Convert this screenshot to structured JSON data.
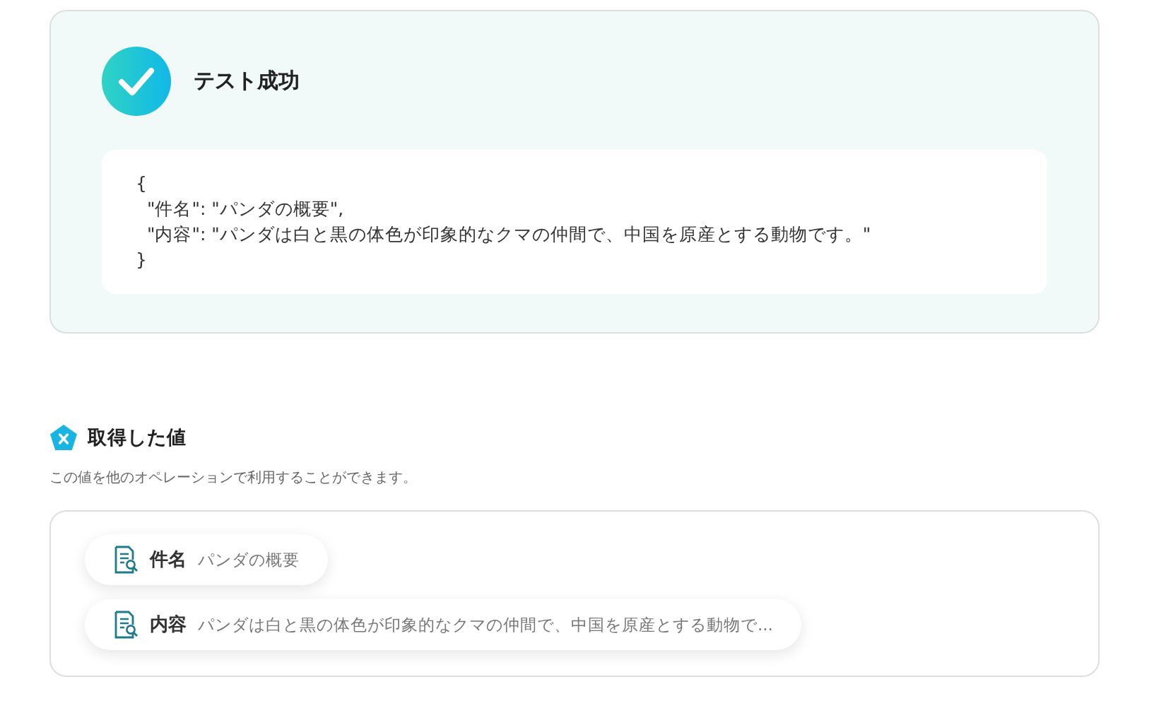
{
  "result": {
    "title": "テスト成功",
    "succeeded": true,
    "code_lines": [
      "{",
      "  \"件名\": \"パンダの概要\",",
      "  \"内容\": \"パンダは白と黒の体色が印象的なクマの仲間で、中国を原産とする動物です。\"",
      "}"
    ]
  },
  "values_section": {
    "title": "取得した値",
    "description": "この値を他のオペレーションで利用することができます。",
    "items": [
      {
        "label": "件名",
        "value": "パンダの概要"
      },
      {
        "label": "内容",
        "value": "パンダは白と黒の体色が印象的なクマの仲間で、中国を原産とする動物で..."
      }
    ]
  }
}
